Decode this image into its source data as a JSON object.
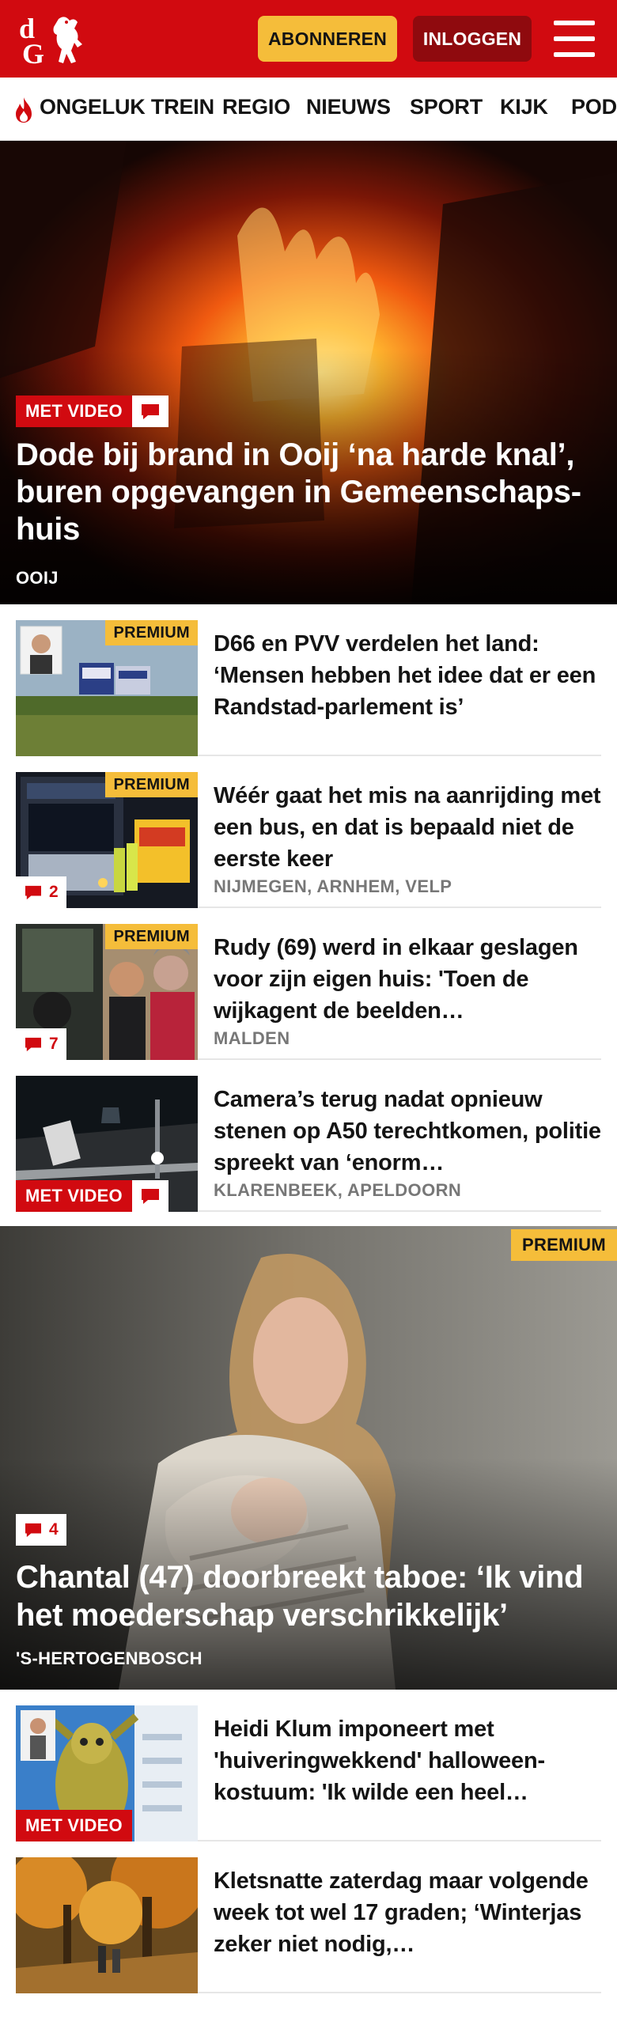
{
  "header": {
    "logo_text": "dG",
    "subscribe_label": "ABONNEREN",
    "login_label": "INLOGGEN",
    "brand_color": "#d10a10"
  },
  "nav": {
    "items": [
      "ONGELUK TREIN",
      "REGIO",
      "NIEUWS",
      "SPORT",
      "KIJK",
      "POD"
    ]
  },
  "hero": {
    "badge": "MET VIDEO",
    "title": "Dode bij brand in Ooij ‘na harde knal’, buren opgevangen in Gemeenschaps­huis",
    "location": "OOIJ"
  },
  "articles": [
    {
      "premium": "PREMIUM",
      "title": "D66 en PVV verdelen het land: ‘Mensen hebben het idee dat er een Randstad-parlement is’",
      "location": "",
      "comments": ""
    },
    {
      "premium": "PREMIUM",
      "title": "Wéér gaat het mis na aanrijding met een bus, en dat is bepaald niet de eerste keer",
      "location": "NIJMEGEN, ARNHEM, VELP",
      "comments": "2"
    },
    {
      "premium": "PREMIUM",
      "title": "Rudy (69) werd in elkaar geslagen voor zijn eigen huis: 'Toen de wijkagent de beelden…",
      "location": "MALDEN",
      "comments": "7"
    },
    {
      "video": "MET VIDEO",
      "title": "Camera’s terug nadat opnieuw stenen op A50 terechtkomen, politie spreekt van ‘enorm…",
      "location": "KLARENBEEK, APELDOORN"
    }
  ],
  "feature": {
    "premium": "PREMIUM",
    "comments": "4",
    "title": "Chantal (47) doorbreekt taboe: ‘Ik vind het moederschap verschrikkelijk’",
    "location": "'S-HERTOGENBOSCH"
  },
  "more_articles": [
    {
      "video": "MET VIDEO",
      "title": "Heidi Klum imponeert met 'huiveringwekkend' halloween­kostuum: 'Ik wilde een heel…"
    },
    {
      "title": "Kletsnatte zaterdag maar volgende week tot wel 17 graden; ‘Winterjas zeker niet nodig,…"
    }
  ]
}
